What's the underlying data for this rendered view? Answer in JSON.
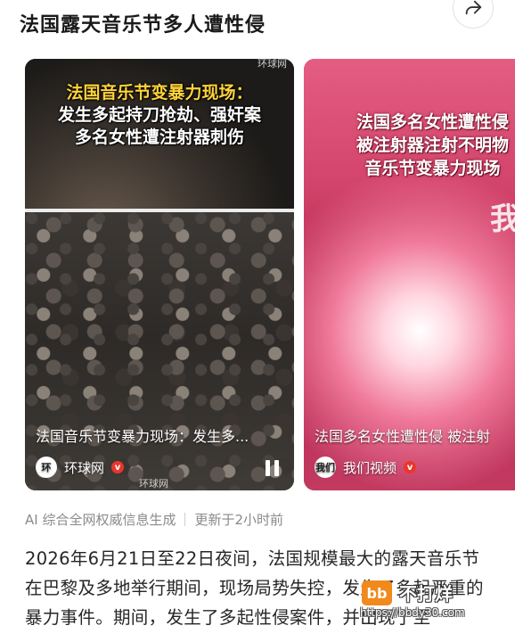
{
  "header": {
    "title": "法国露天音乐节多人遭性侵",
    "share_icon": "share-arrow-icon"
  },
  "videos": [
    {
      "overlay": [
        "法国音乐节变暴力现场：",
        "发生多起持刀抢劫、强奸案",
        "多名女性遭注射器刺伤"
      ],
      "top_watermark": "环球网",
      "caption": "法国音乐节变暴力现场：发生多...",
      "source_avatar": "环",
      "source": "环球网",
      "verified_mark": "v",
      "bottom_watermark": "环球网",
      "control_icon": "pause-icon"
    },
    {
      "overlay": [
        "法国多名女性遭性侵",
        "被注射器注射不明物",
        "音乐节变暴力现场"
      ],
      "big_char": "我",
      "caption": "法国多名女性遭性侵 被注射",
      "source_avatar": "我们",
      "source": "我们视频",
      "verified_mark": "v"
    }
  ],
  "meta": {
    "generated": "AI 综合全网权威信息生成",
    "updated": "更新于2小时前"
  },
  "body_text": "2026年6月21日至22日夜间，法国规模最大的露天音乐节在巴黎及多地举行期间，现场局势失控，发生了多起严重的暴力事件。期间，发生了多起性侵案件，并出现了至",
  "site_watermark": {
    "logo": "bb",
    "name": "不打烊",
    "url": "https://bbdy30.com"
  },
  "colors": {
    "overlay_highlight": "#ffd33a",
    "verified_badge": "#e8372c",
    "card2_bg": "#c83a5e",
    "site_logo": "#f08a1d"
  }
}
